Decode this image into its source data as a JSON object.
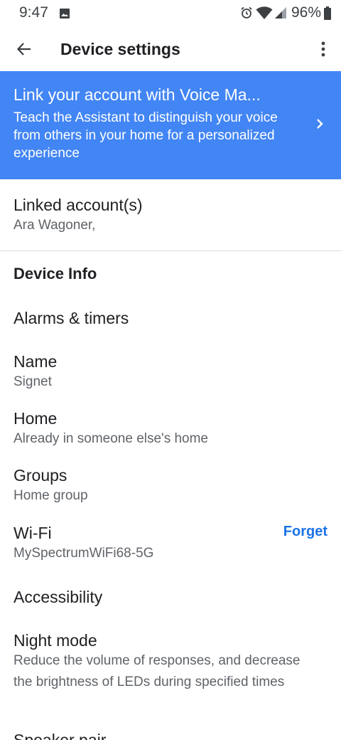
{
  "status_bar": {
    "time": "9:47",
    "battery": "96%",
    "icons": [
      "photo-icon",
      "alarm-icon",
      "wifi-icon",
      "signal-icon",
      "battery-icon"
    ]
  },
  "app_bar": {
    "title": "Device settings",
    "back_icon": "arrow-back-icon",
    "overflow_icon": "more-vert-icon"
  },
  "banner": {
    "title": "Link your account with Voice Ma...",
    "description": "Teach the Assistant to distinguish your voice from others in your home for a personalized experience",
    "chevron_icon": "chevron-right-icon",
    "background_color": "#4285f4"
  },
  "linked_accounts": {
    "title": "Linked account(s)",
    "subtitle": "Ara Wagoner,"
  },
  "device_info": {
    "header": "Device Info",
    "items": [
      {
        "title": "Alarms & timers"
      },
      {
        "title": "Name",
        "subtitle": "Signet"
      },
      {
        "title": "Home",
        "subtitle": "Already in someone else's home"
      },
      {
        "title": "Groups",
        "subtitle": "Home group"
      },
      {
        "title": "Wi-Fi",
        "subtitle": "MySpectrumWiFi68-5G",
        "action": "Forget"
      },
      {
        "title": "Accessibility"
      },
      {
        "title": "Night mode",
        "subtitle": "Reduce the volume of responses, and decrease the brightness of LEDs during specified times"
      },
      {
        "title": "Speaker pair"
      }
    ]
  },
  "colors": {
    "accent": "#1a73e8",
    "text_primary": "#202124",
    "text_secondary": "#5f6368"
  }
}
